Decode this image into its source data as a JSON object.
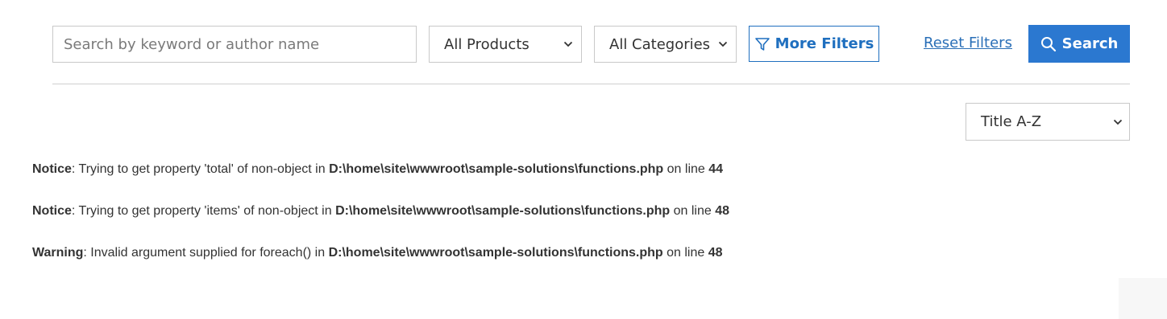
{
  "filters": {
    "search": {
      "placeholder": "Search by keyword or author name",
      "value": ""
    },
    "products_select": {
      "selected": "All Products"
    },
    "categories_select": {
      "selected": "All Categories"
    },
    "more_filters_label": "More Filters",
    "reset_label": "Reset Filters",
    "search_button_label": "Search"
  },
  "sort": {
    "selected": "Title A-Z"
  },
  "messages": [
    {
      "level": "Notice",
      "text": ": Trying to get property 'total' of non-object in ",
      "path": "D:\\home\\site\\wwwroot\\sample-solutions\\functions.php",
      "on_line": " on line ",
      "line": "44"
    },
    {
      "level": "Notice",
      "text": ": Trying to get property 'items' of non-object in ",
      "path": "D:\\home\\site\\wwwroot\\sample-solutions\\functions.php",
      "on_line": " on line ",
      "line": "48"
    },
    {
      "level": "Warning",
      "text": ": Invalid argument supplied for foreach() in ",
      "path": "D:\\home\\site\\wwwroot\\sample-solutions\\functions.php",
      "on_line": " on line ",
      "line": "48"
    }
  ],
  "colors": {
    "accent": "#2b78d0",
    "link": "#2a6fb7",
    "border": "#c9c9c9"
  },
  "icons": {
    "filter": "funnel-icon",
    "search": "search-icon",
    "dropdown": "chevron-down-icon"
  }
}
